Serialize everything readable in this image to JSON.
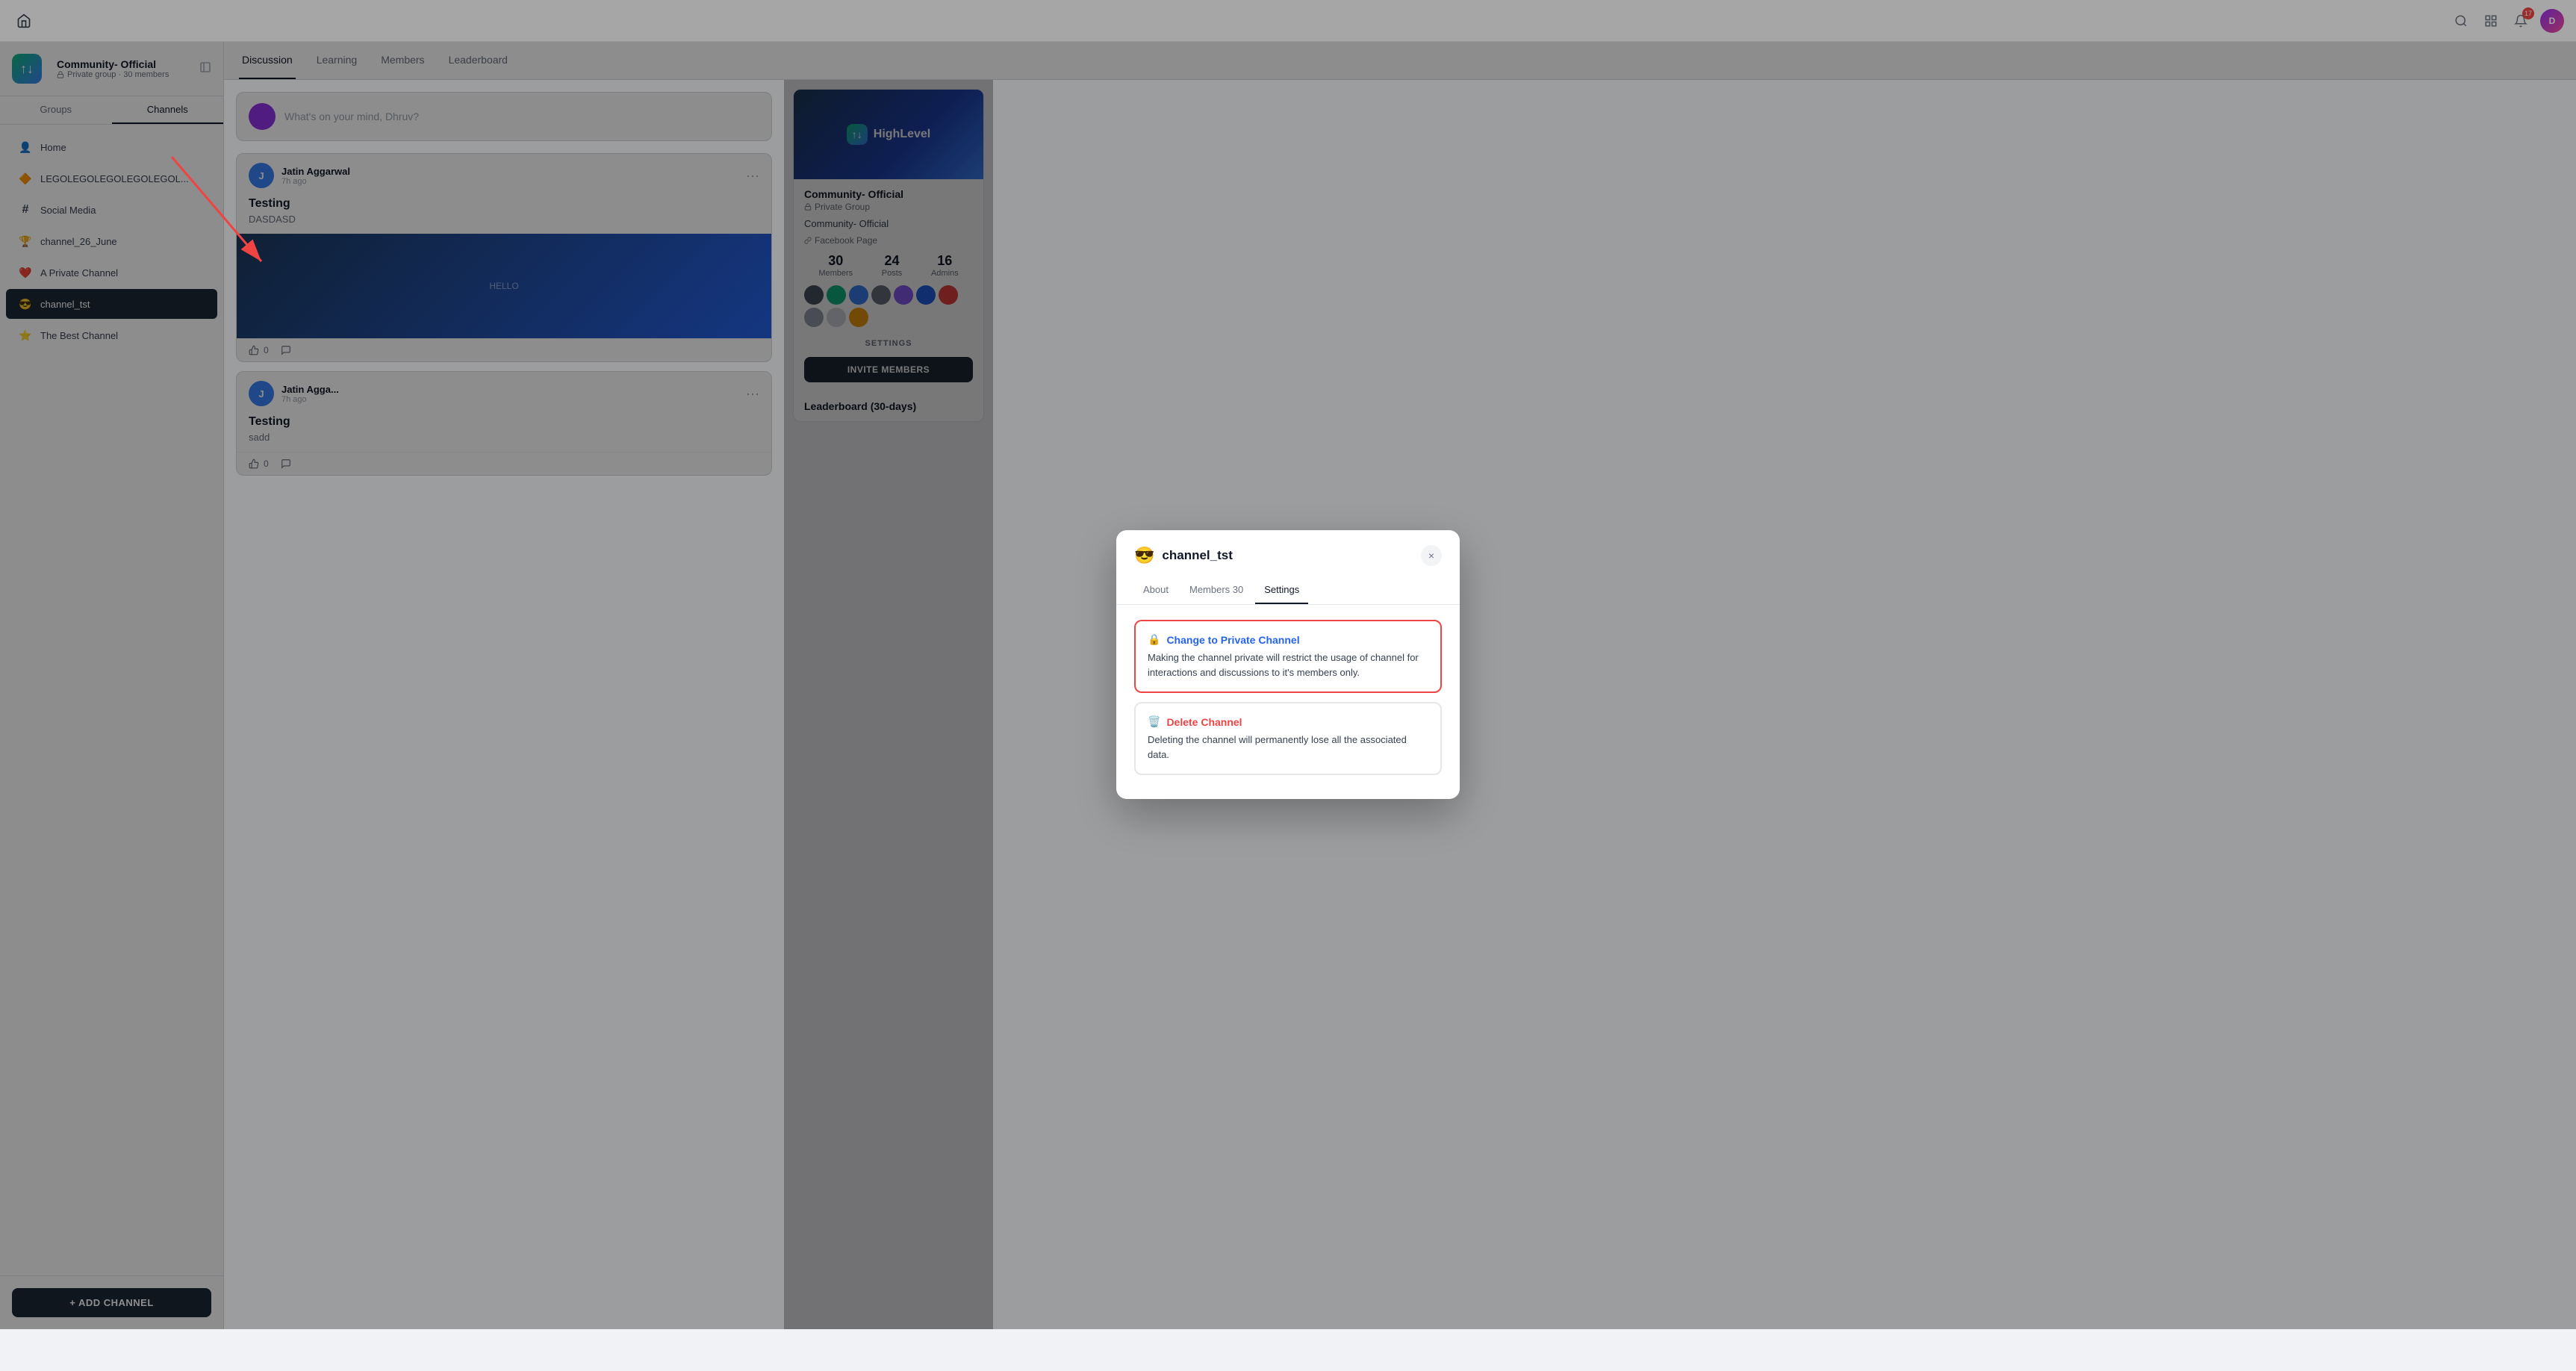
{
  "app": {
    "title": "Community - Official"
  },
  "topnav": {
    "notification_count": "17",
    "avatar_initials": "D"
  },
  "sidebar": {
    "logo": "↑↓",
    "community_name": "Community- Official",
    "community_meta": "Private group · 30 members",
    "tabs": [
      {
        "label": "Groups",
        "active": false
      },
      {
        "label": "Channels",
        "active": true
      }
    ],
    "nav_items": [
      {
        "icon": "👤",
        "label": "Home",
        "active": false
      },
      {
        "icon": "🔶",
        "label": "LEGOLEGOLEGOLEGOLEGOL...",
        "active": false
      },
      {
        "icon": "#",
        "label": "Social Media",
        "active": false
      },
      {
        "icon": "🏆",
        "label": "channel_26_June",
        "active": false
      },
      {
        "icon": "❤️",
        "label": "A Private Channel",
        "active": false
      },
      {
        "icon": "😎",
        "label": "channel_tst",
        "active": true
      },
      {
        "icon": "⭐",
        "label": "The Best Channel",
        "active": false
      }
    ],
    "add_channel_label": "+ ADD CHANNEL"
  },
  "main_tabs": [
    {
      "label": "Discussion",
      "active": true
    },
    {
      "label": "Learning",
      "active": false
    },
    {
      "label": "Members",
      "active": false
    },
    {
      "label": "Leaderboard",
      "active": false
    }
  ],
  "post_input": {
    "placeholder": "What's on your mind, Dhruv?"
  },
  "posts": [
    {
      "author": "Jatin Aggarwal",
      "avatar_initials": "J",
      "time": "7h ago",
      "title": "Testing",
      "subtitle": "DASDASD"
    },
    {
      "author": "Jatin Agga...",
      "avatar_initials": "J",
      "time": "7h ago",
      "title": "Testing",
      "subtitle": "sadd"
    }
  ],
  "right_panel": {
    "banner_brand": "↑↓ HighLevel",
    "community_title": "Community- Official",
    "community_type": "Private Group",
    "community_name2": "Community- Official",
    "facebook_page": "Facebook Page",
    "stats": {
      "members": "30",
      "members_label": "Members",
      "posts": "24",
      "posts_label": "Posts",
      "admins": "16",
      "admins_label": "Admins"
    },
    "settings_label": "SETTINGS",
    "invite_btn": "INVITE MEMBERS",
    "leaderboard_title": "Leaderboard (30-days)"
  },
  "modal": {
    "emoji": "😎",
    "title": "channel_tst",
    "tabs": [
      {
        "label": "About",
        "active": false
      },
      {
        "label": "Members 30",
        "active": false
      },
      {
        "label": "Settings",
        "active": true
      }
    ],
    "settings": [
      {
        "id": "private",
        "icon": "🔒",
        "title": "Change to Private Channel",
        "title_color": "blue",
        "description": "Making the channel private will restrict the usage of channel for interactions and discussions to it's members only.",
        "highlighted": true
      },
      {
        "id": "delete",
        "icon": "🗑️",
        "title": "Delete Channel",
        "title_color": "red",
        "description": "Deleting the channel will permanently lose all the associated data.",
        "highlighted": false
      }
    ],
    "close_label": "×"
  }
}
